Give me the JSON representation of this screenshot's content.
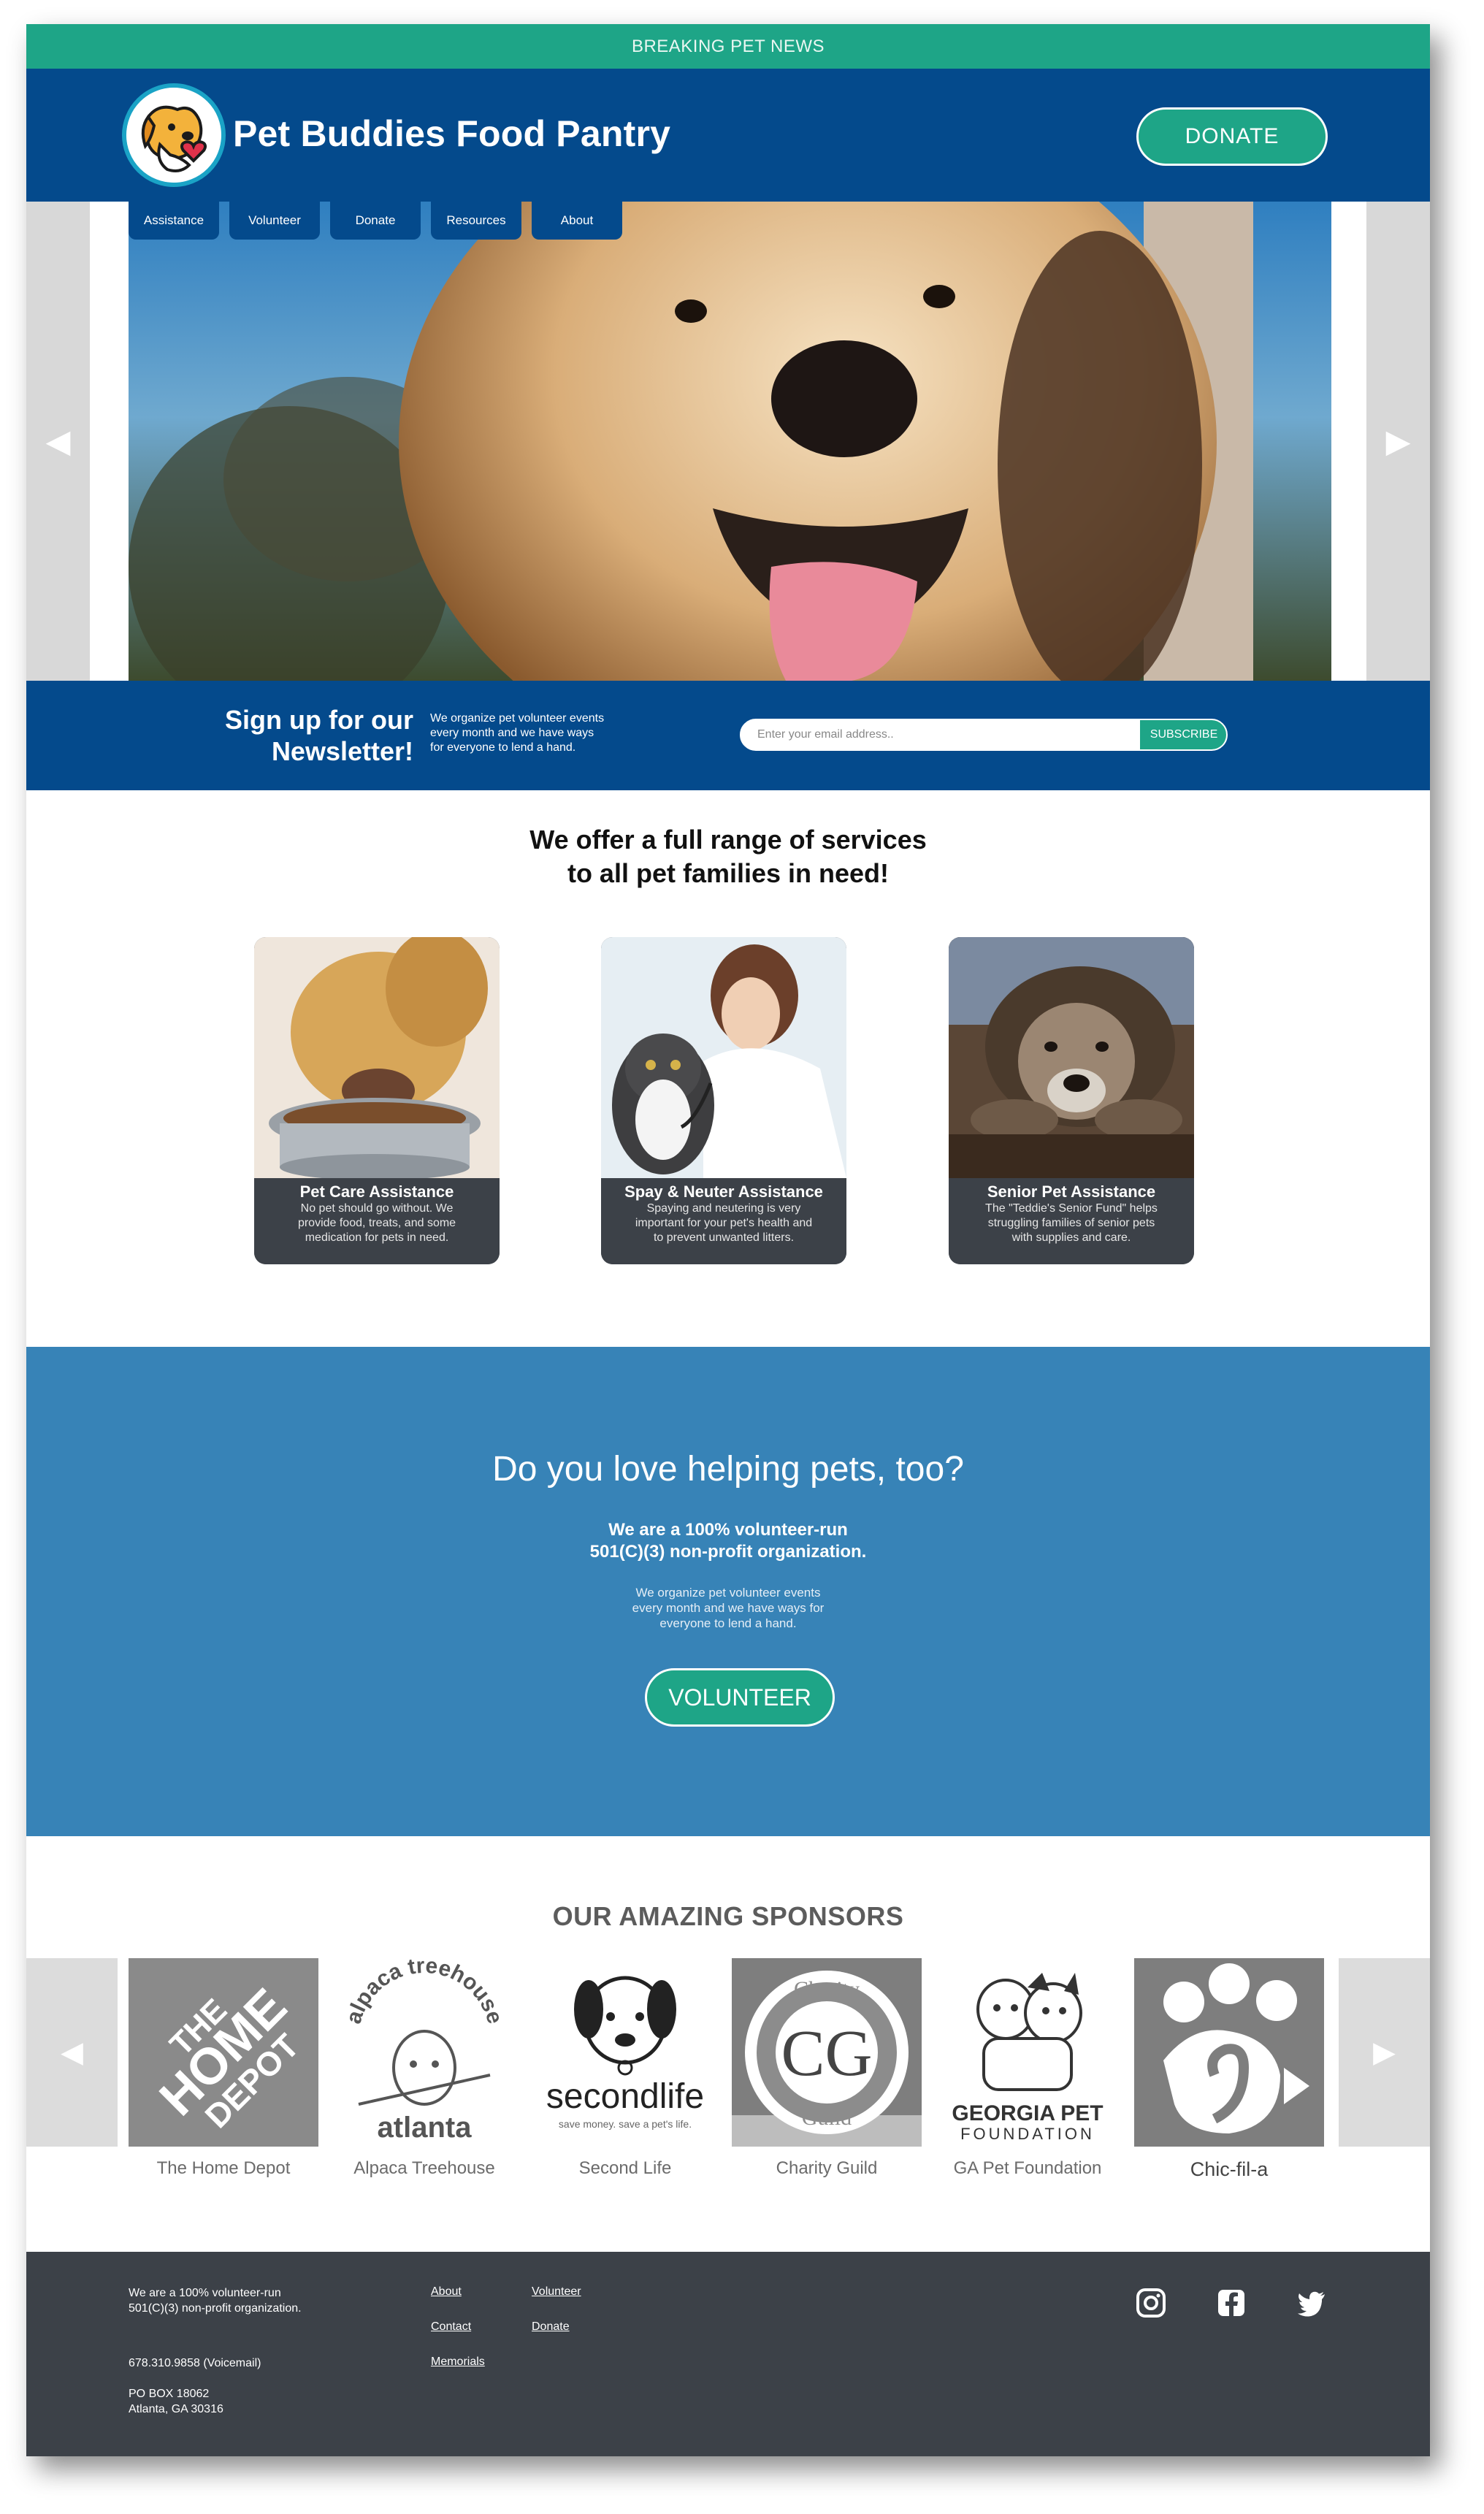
{
  "top_bar": {
    "text": "BREAKING PET NEWS"
  },
  "header": {
    "brand": "Pet Buddies Food Pantry",
    "donate_label": "DONATE"
  },
  "nav": {
    "items": [
      {
        "label": "Assistance"
      },
      {
        "label": "Volunteer"
      },
      {
        "label": "Donate"
      },
      {
        "label": "Resources"
      },
      {
        "label": "About"
      }
    ]
  },
  "newsletter": {
    "title_line1": "Sign up for our",
    "title_line2": "Newsletter!",
    "desc_line1": "We organize pet volunteer events",
    "desc_line2": "every month and we have ways",
    "desc_line3": "for everyone to lend a hand.",
    "placeholder": "Enter your email address..",
    "subscribe_label": "SUBSCRIBE"
  },
  "services": {
    "title_line1": "We offer a full range of services",
    "title_line2": "to all pet families in need!",
    "cards": [
      {
        "title": "Pet Care Assistance",
        "line1": "No pet should go without. We",
        "line2": "provide food, treats, and some",
        "line3": "medication for pets in need."
      },
      {
        "title": "Spay & Neuter Assistance",
        "line1": "Spaying and neutering is very",
        "line2": "important for your pet's health and",
        "line3": "to prevent unwanted litters."
      },
      {
        "title": "Senior Pet Assistance",
        "line1": "The \"Teddie's Senior Fund\" helps",
        "line2": "struggling families of senior pets",
        "line3": "with supplies and care."
      }
    ]
  },
  "volunteer": {
    "title": "Do you love helping pets, too?",
    "sub_line1": "We are a 100% volunteer-run",
    "sub_line2": "501(C)(3) non-profit organization.",
    "desc_line1": "We organize pet volunteer events",
    "desc_line2": "every month and we have ways for",
    "desc_line3": "everyone to lend a hand.",
    "button_label": "VOLUNTEER"
  },
  "sponsors": {
    "title": "OUR AMAZING SPONSORS",
    "items": [
      {
        "name": "The Home Depot",
        "logo_text1": "THE",
        "logo_text2": "HOME",
        "logo_text3": "DEPOT"
      },
      {
        "name": "Alpaca Treehouse",
        "logo_text1": "alpaca treehouse",
        "logo_text2": "atlanta"
      },
      {
        "name": "Second Life",
        "logo_text1": "secondlife",
        "logo_text2": "save money. save a pet's life."
      },
      {
        "name": "Charity Guild",
        "logo_text1": "Charity",
        "logo_text2": "Guild",
        "logo_text3": "CG"
      },
      {
        "name": "GA Pet Foundation",
        "logo_text1": "GEORGIA PET",
        "logo_text2": "FOUNDATION"
      },
      {
        "name": "Chic-fil-a"
      }
    ]
  },
  "footer": {
    "about_line1": "We are a 100% volunteer-run",
    "about_line2": "501(C)(3) non-profit organization.",
    "phone": "678.310.9858 (Voicemail)",
    "address_line1": "PO BOX 18062",
    "address_line2": "Atlanta, GA 30316",
    "links": {
      "about": "About",
      "volunteer": "Volunteer",
      "contact": "Contact",
      "donate": "Donate",
      "memorials": "Memorials"
    },
    "social_icons": [
      "instagram-icon",
      "facebook-icon",
      "twitter-icon"
    ]
  },
  "colors": {
    "teal": "#1ea587",
    "navy": "#044a8c",
    "sky": "#3783b7",
    "dark": "#3c4148"
  }
}
